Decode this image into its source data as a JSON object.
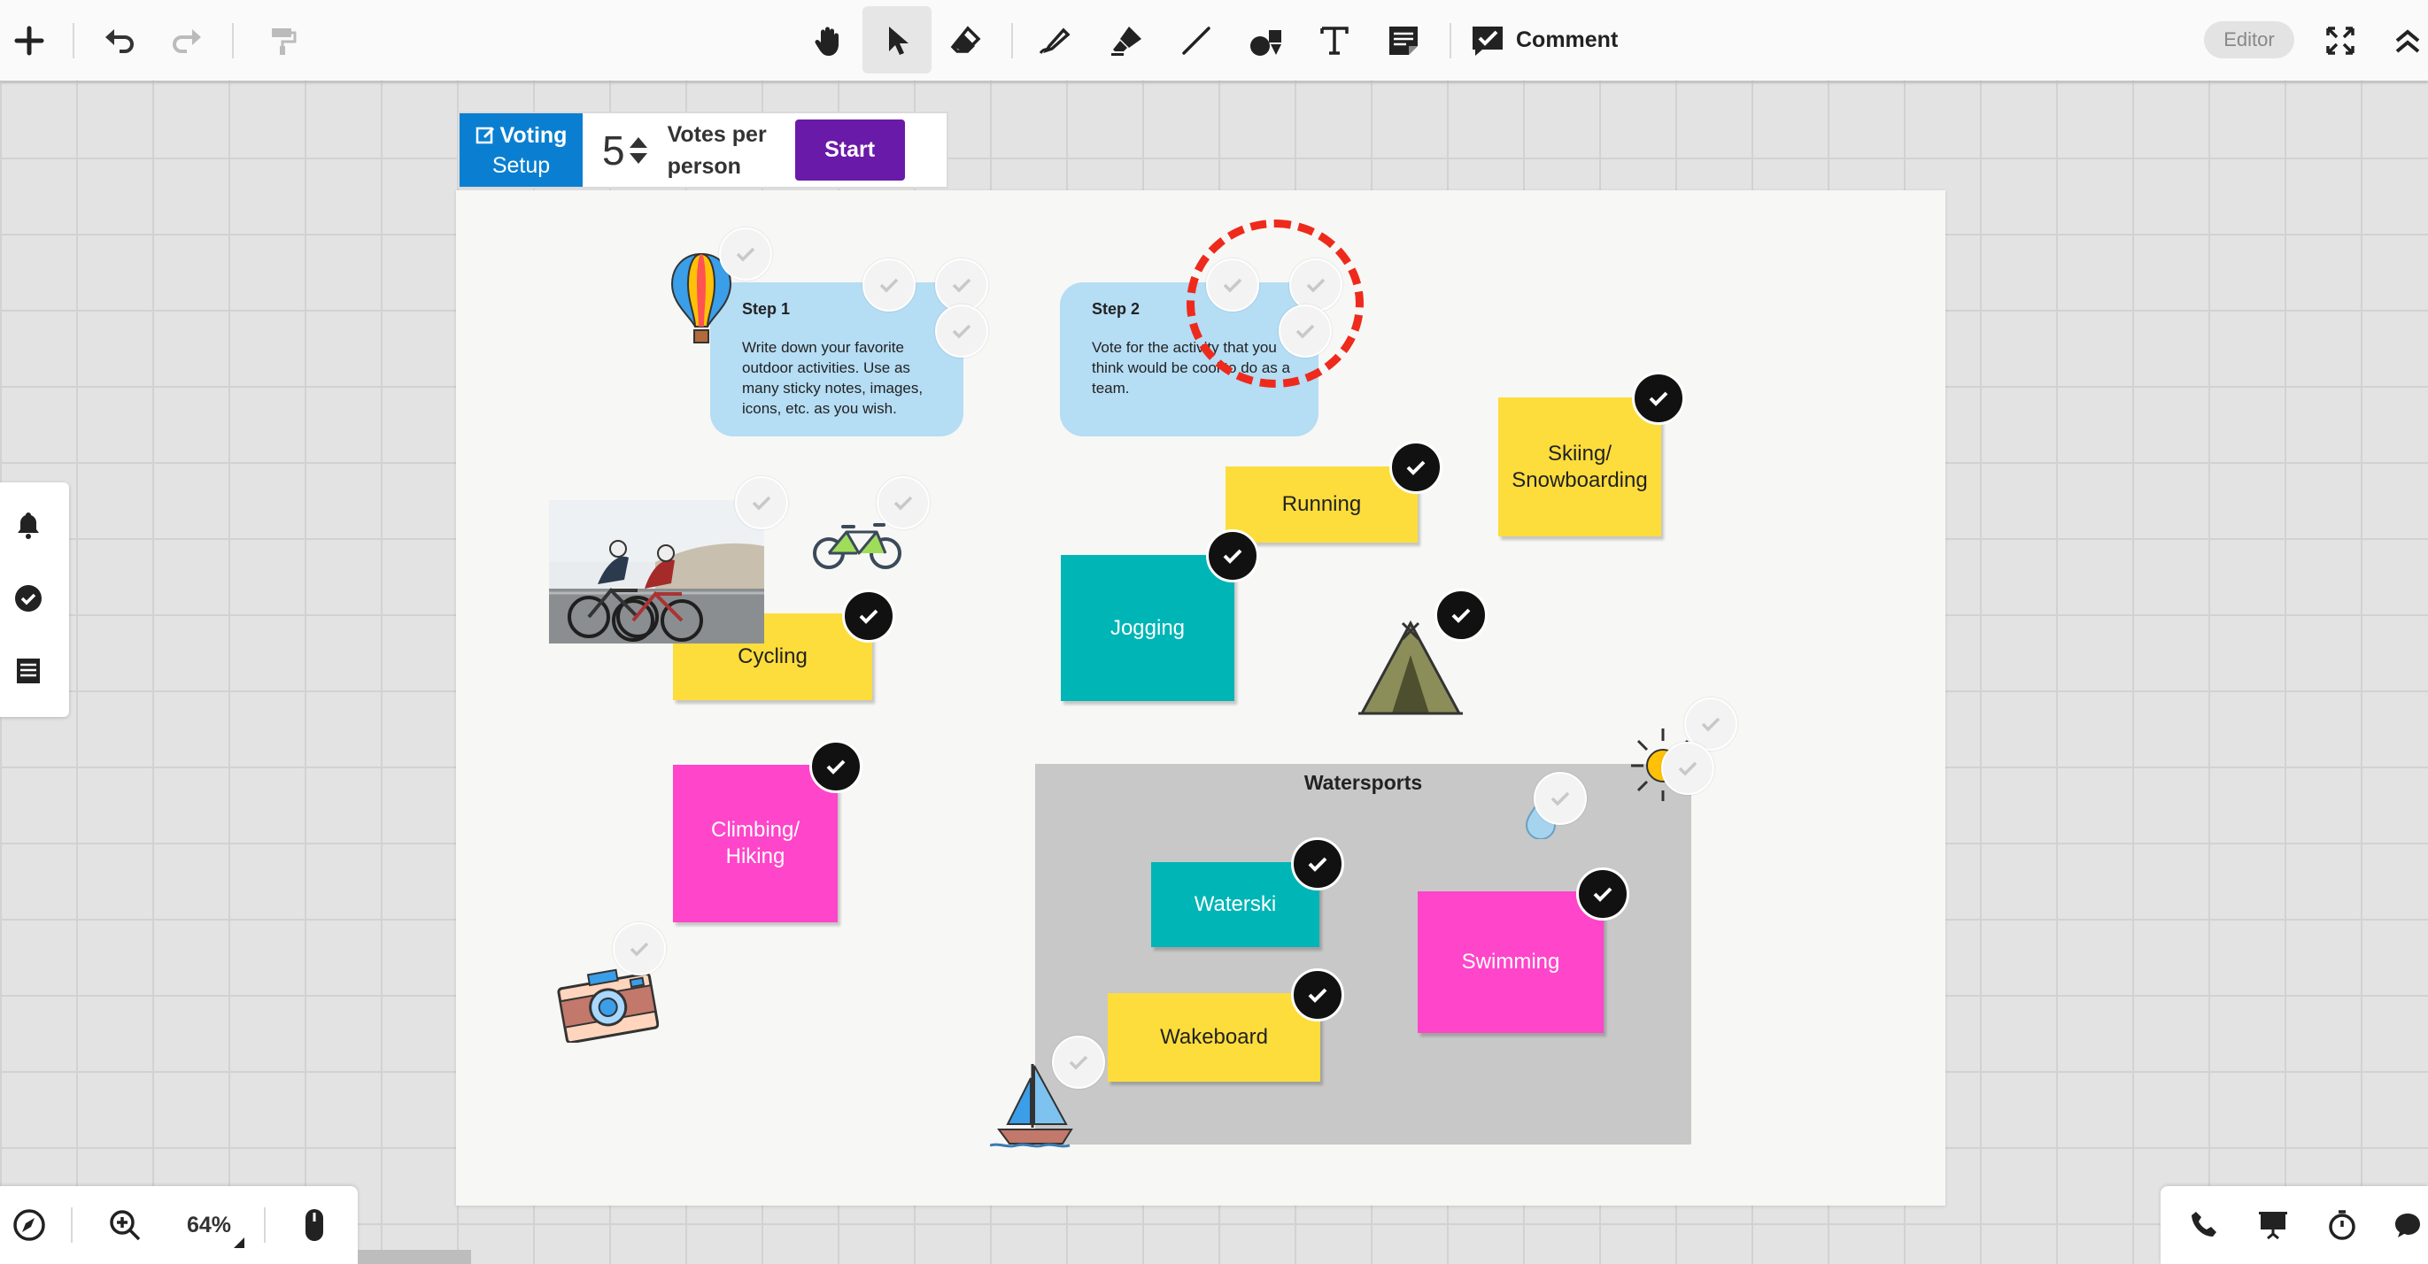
{
  "toolbar": {
    "comment_label": "Comment",
    "mode_label": "Editor"
  },
  "voting": {
    "setup_line1": "Voting",
    "setup_line2": "Setup",
    "votes_count": "5",
    "votes_label": "Votes per person",
    "start_label": "Start"
  },
  "steps": [
    {
      "title": "Step 1",
      "body": "Write down your favorite outdoor activities. Use as many sticky notes, images, icons, etc. as you wish."
    },
    {
      "title": "Step 2",
      "body": "Vote for the activity that you think would be cool to do as a team."
    }
  ],
  "stickies": {
    "running": "Running",
    "skiing": "Skiing/ Snowboarding",
    "jogging": "Jogging",
    "cycling": "Cycling",
    "climbing": "Climbing/ Hiking",
    "waterski": "Waterski",
    "swimming": "Swimming",
    "wakeboard": "Wakeboard"
  },
  "frame": {
    "title": "Watersports"
  },
  "zoom": {
    "level": "64%"
  },
  "colors": {
    "accent_blue": "#0a7fd1",
    "start_purple": "#6a1aa8",
    "sticky_yellow": "#fddd3c",
    "sticky_teal": "#00b5b6",
    "sticky_pink": "#ff45c9",
    "step_blue": "#b5ddf4",
    "highlight_red": "#ee2a1c"
  },
  "icons": {
    "toolbar": [
      "plus-icon",
      "undo-icon",
      "redo-icon",
      "format-painter-icon",
      "hand-icon",
      "select-arrow-icon",
      "eraser-icon",
      "pen-icon",
      "highlighter-icon",
      "line-icon",
      "shapes-icon",
      "text-icon",
      "sticky-note-icon",
      "comment-icon",
      "fullscreen-icon",
      "collapse-icon"
    ],
    "side_panel": [
      "bell-icon",
      "check-circle-icon",
      "list-icon"
    ],
    "bottom_left": [
      "compass-icon",
      "zoom-in-icon",
      "mouse-icon"
    ],
    "bottom_right": [
      "phone-icon",
      "presentation-icon",
      "timer-icon",
      "chat-icon"
    ],
    "board": [
      "hot-air-balloon-icon",
      "bicycle-icon",
      "tent-icon",
      "sun-icon",
      "water-drop-icon",
      "camera-icon",
      "sailboat-icon",
      "cycling-photo"
    ]
  }
}
